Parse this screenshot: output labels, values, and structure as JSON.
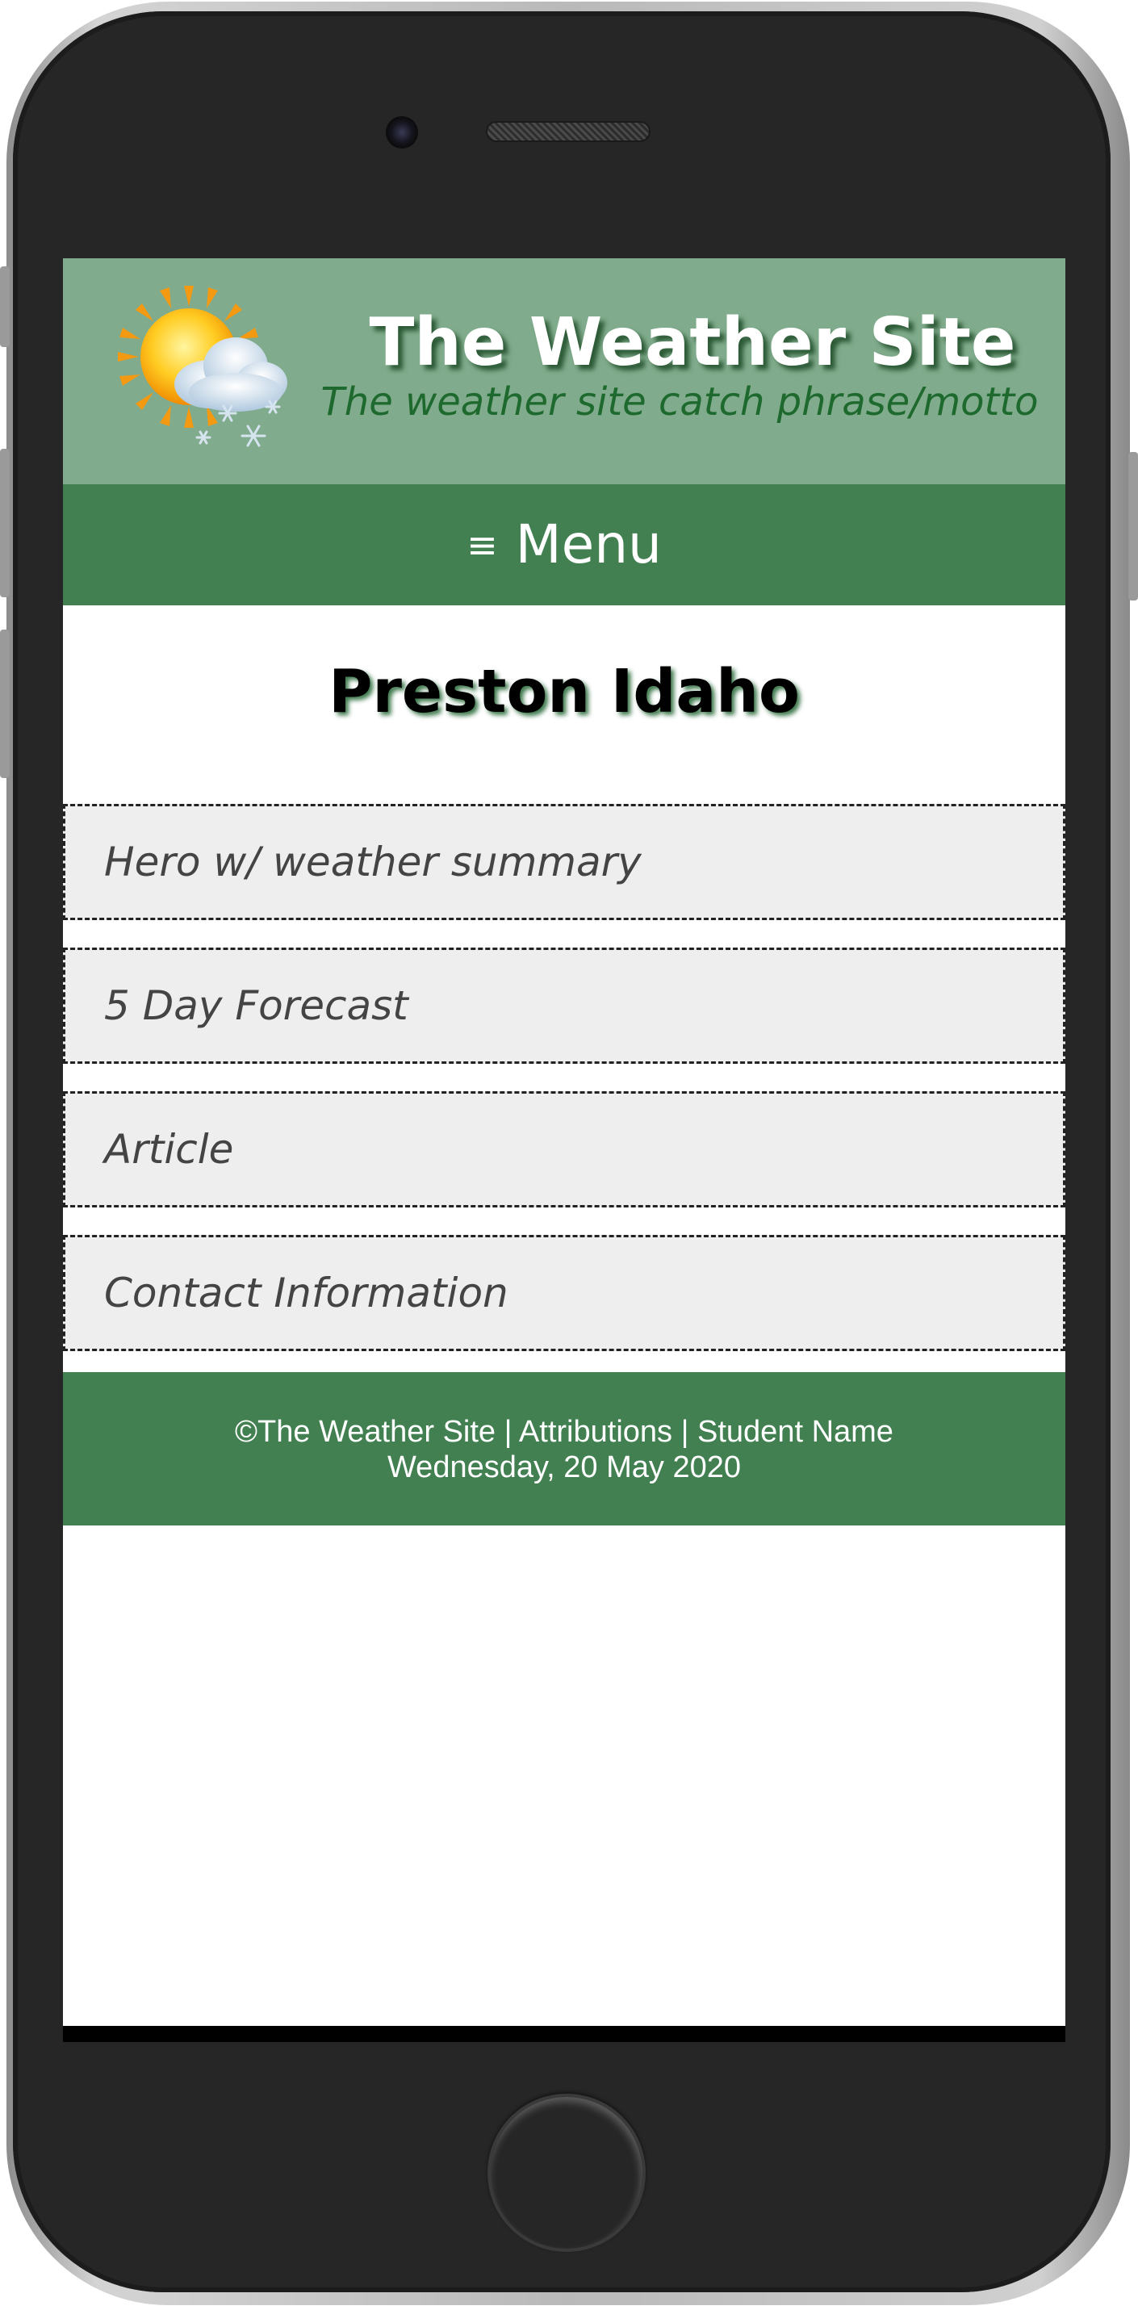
{
  "header": {
    "title": "The Weather Site",
    "motto": "The weather site catch phrase/motto",
    "logo_icon": "sun-cloud-snow-icon"
  },
  "nav": {
    "icon": "≡",
    "label": "Menu"
  },
  "main": {
    "city_title": "Preston Idaho",
    "sections": [
      "Hero w/ weather summary",
      "5 Day Forecast",
      "Article",
      "Contact Information"
    ]
  },
  "footer": {
    "line1": "©The Weather Site | Attributions | Student Name",
    "line2": "Wednesday, 20 May 2020"
  },
  "colors": {
    "header_bg": "#80ab8c",
    "nav_bg": "#428052",
    "section_bg": "#eeeeee",
    "motto": "#1e6a2e"
  }
}
